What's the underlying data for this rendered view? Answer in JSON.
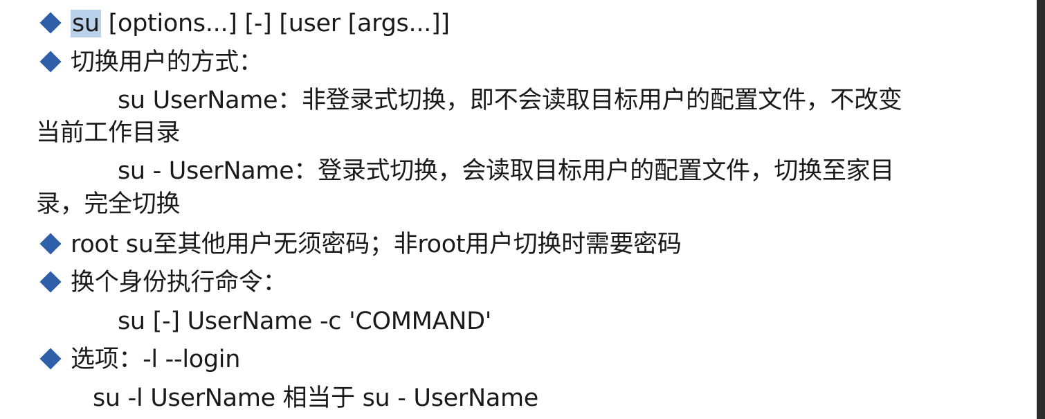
{
  "lines": {
    "syntax": {
      "cmd": "su",
      "rest": " [options...] [-] [user [args...]]"
    },
    "switch_ways_title": "切换用户的方式：",
    "su_nonlogin_1": "su UserName：非登录式切换，即不会读取目标用户的配置文件，不改变",
    "su_nonlogin_2": "当前工作目录",
    "su_login_1": "su - UserName：登录式切换，会读取目标用户的配置文件，切换至家目",
    "su_login_2": "录，完全切换",
    "root_note": "root su至其他用户无须密码；非root用户切换时需要密码",
    "run_as_title": "换个身份执行命令：",
    "run_as_cmd": "su [-] UserName -c 'COMMAND'",
    "options_title": "选项：-l  --login",
    "options_example": "su -l UserName  相当于 su - UserName"
  },
  "colors": {
    "bullet": "#2e5fa8",
    "highlight": "#b9d1ea",
    "text": "#1a1a1a"
  },
  "icons": {
    "bullet": "diamond-bullet-icon"
  }
}
